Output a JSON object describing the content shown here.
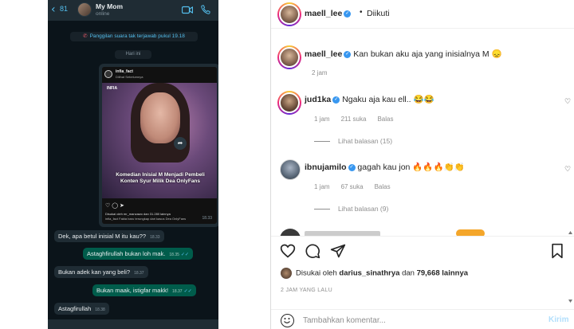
{
  "whatsapp": {
    "back_count": "81",
    "contact_name": "My Mom",
    "contact_status": "online",
    "missed_call": "Panggilan suara tak terjawab pukul 19.18",
    "date_chip": "Hari ini",
    "forwarded_post": {
      "account": "infia_fact",
      "account_sub": "Dilihat Sebelumnya",
      "logo": "INFIA",
      "headline": "Komedian Inisial M Menjadi Pembeli Konten Syur Milik Dea OnlyFans",
      "likes": "Disukai oleh mr_manzawo dan 31.280 lainnya",
      "caption": "infia_fact Fakta baru terungkap dari kasus Dea OnlyFans",
      "time": "18.33"
    },
    "messages": [
      {
        "dir": "in",
        "text": "Dek, apa betul inisial M itu kau??",
        "time": "18.33"
      },
      {
        "dir": "out",
        "text": "Astaghfirullah bukan loh mak.",
        "time": "18.35"
      },
      {
        "dir": "in",
        "text": "Bukan adek kan yang beli?",
        "time": "18.37"
      },
      {
        "dir": "out",
        "text": "Bukan maak, istigfar makk!",
        "time": "18.37"
      },
      {
        "dir": "in",
        "text": "Astagfirullah",
        "time": "18.38"
      }
    ]
  },
  "instagram": {
    "header": {
      "username": "maell_lee",
      "separator": "•",
      "follow_status": "Diikuti"
    },
    "caption": {
      "username": "maell_lee",
      "text": "Kan bukan aku aja yang inisialnya M",
      "emoji": "😞",
      "time": "2 jam"
    },
    "comments": [
      {
        "username": "jud1ka",
        "text": "Ngaku aja kau ell..",
        "emoji": "😂😂",
        "time": "1 jam",
        "likes": "211 suka",
        "reply": "Balas",
        "view_replies": "Lihat balasan (15)"
      },
      {
        "username": "ibnujamilo",
        "text": "gagah kau jon",
        "emoji": "🔥🔥🔥👏👏",
        "time": "1 jam",
        "likes": "67 suka",
        "reply": "Balas",
        "view_replies": "Lihat balasan (9)"
      }
    ],
    "liked_by": {
      "prefix": "Disukai oleh",
      "user": "darius_sinathrya",
      "joiner": "dan",
      "count": "79,668 lainnya"
    },
    "time_ago": "2 JAM YANG LALU",
    "comment_input": {
      "placeholder": "Tambahkan komentar..."
    },
    "send_label": "Kirim",
    "colors": {
      "verified": "#3897f0",
      "wa_out_bubble": "#005c4b",
      "wa_in_bubble": "#1f2c34",
      "link_blue": "#b2dffc"
    }
  }
}
